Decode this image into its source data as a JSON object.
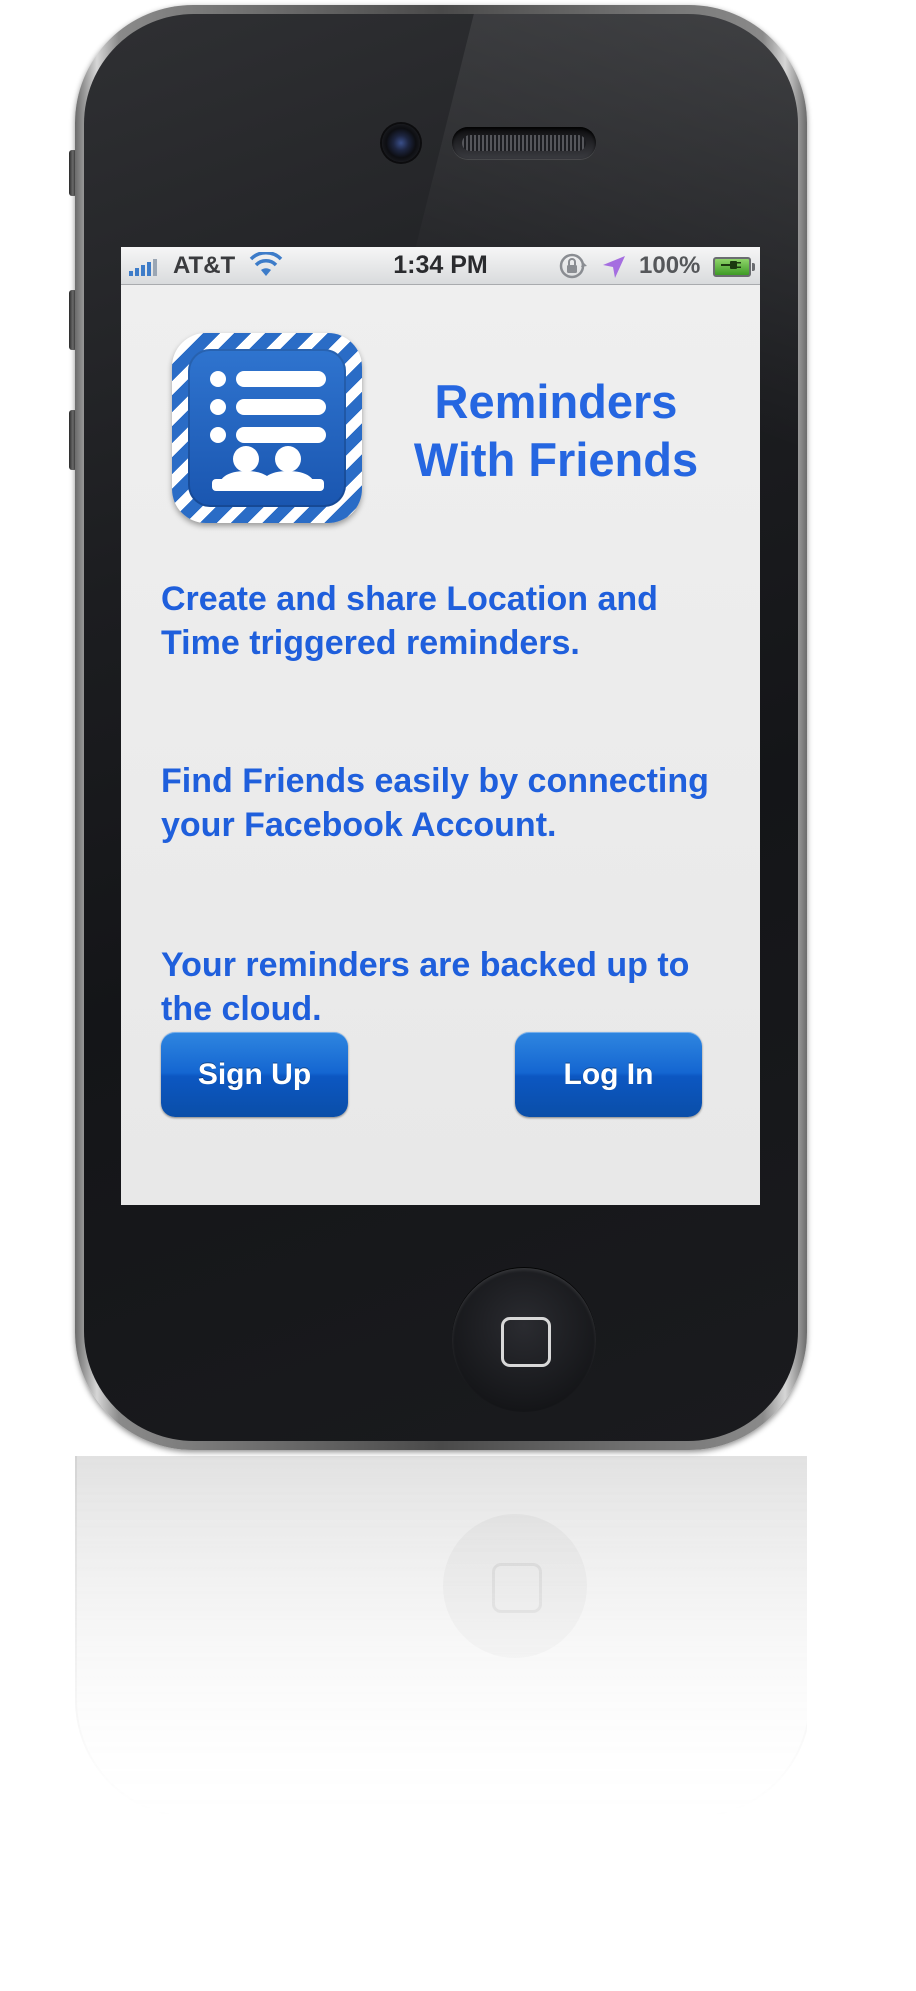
{
  "status_bar": {
    "carrier": "AT&T",
    "time": "1:34 PM",
    "battery": "100%",
    "icons": [
      "signal-bars-icon",
      "wifi-icon",
      "rotation-lock-icon",
      "location-arrow-icon",
      "battery-charging-icon"
    ]
  },
  "app": {
    "icon": "reminders-friends-app-icon",
    "title_line1": "Reminders",
    "title_line2": "With Friends"
  },
  "descriptions": [
    "Create and share Location and Time triggered reminders.",
    "Find Friends easily by connecting your Facebook Account.",
    "Your reminders are backed up to the cloud."
  ],
  "buttons": {
    "sign_up": "Sign Up",
    "log_in": "Log In"
  },
  "colors": {
    "text_blue": "#1f5fdc",
    "button_blue": "#1466d1",
    "screen_bg": "#ebebeb"
  }
}
